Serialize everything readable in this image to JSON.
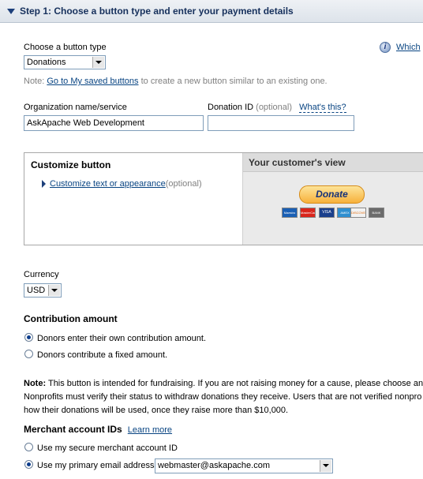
{
  "step": {
    "title": "Step 1: Choose a button type and enter your payment details"
  },
  "button_type": {
    "label": "Choose a button type",
    "value": "Donations",
    "help_link": "Which"
  },
  "note": {
    "prefix": "Note:",
    "link": "Go to My saved buttons",
    "suffix": "to create a new button similar to an existing one."
  },
  "org": {
    "label": "Organization name/service",
    "value": "AskApache Web Development"
  },
  "donation_id": {
    "label": "Donation ID",
    "optional": "(optional)",
    "help": "What's this?",
    "value": ""
  },
  "customize": {
    "title": "Customize button",
    "link": "Customize text or appearance",
    "optional": "(optional)",
    "preview_title": "Your customer's view",
    "donate_label": "Donate",
    "cards": [
      "Maestro",
      "MasterCard",
      "VISA",
      "AMEX",
      "DISCOVER",
      "BANK"
    ]
  },
  "currency": {
    "label": "Currency",
    "value": "USD"
  },
  "contribution": {
    "title": "Contribution amount",
    "options": [
      {
        "label": "Donors enter their own contribution amount.",
        "checked": true
      },
      {
        "label": "Donors contribute a fixed amount.",
        "checked": false
      }
    ]
  },
  "fund_note": {
    "bold": "Note:",
    "line1": "This button is intended for fundraising. If you are not raising money for a cause, please choose and",
    "line2": "Nonprofits must verify their status to withdraw donations they receive. Users that are not verified nonpro",
    "line3": "how their donations will be used, once they raise more than $10,000."
  },
  "merchant": {
    "title": "Merchant account IDs",
    "learn_more": "Learn more",
    "options": [
      {
        "label": "Use my secure merchant account ID",
        "checked": false
      },
      {
        "label": "Use my primary email address",
        "checked": true
      }
    ],
    "email": "webmaster@askapache.com"
  },
  "colors": {
    "link": "#084482",
    "header_text": "#16305c"
  }
}
